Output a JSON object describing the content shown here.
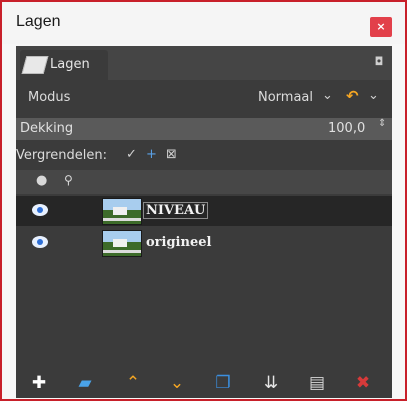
{
  "window": {
    "title": "Lagen",
    "close_glyph": "×"
  },
  "tab": {
    "label": "Lagen",
    "icon": "layers-icon",
    "menu_glyph": "◘"
  },
  "mode": {
    "label": "Modus",
    "value": "Normaal",
    "chevron": "⌄",
    "swap_glyph": "↶",
    "reset_chevron": "⌄"
  },
  "opacity": {
    "label": "Dekking",
    "value": "100,0",
    "spin_glyph": "⇕"
  },
  "lock": {
    "label": "Vergrendelen:",
    "pixels_glyph": "✓",
    "position_glyph": "+",
    "alpha_glyph": "⊠"
  },
  "list_header": {
    "eye_glyph": "●",
    "chain_glyph": "⚲"
  },
  "layers": [
    {
      "name": "NIVEAU",
      "visible": true,
      "selected": true
    },
    {
      "name": "origineel",
      "visible": true,
      "selected": false
    }
  ],
  "bottom_bar": {
    "new_layer": "✚",
    "new_group": "▰",
    "raise": "⌃",
    "lower": "⌄",
    "duplicate": "❐",
    "merge": "⇊",
    "anchor": "▤",
    "delete": "✖"
  },
  "colors": {
    "window_border": "#c8202a",
    "panel_bg": "#3b3b3b",
    "accent_orange": "#f5a623",
    "accent_blue": "#2e6fd6",
    "delete_red": "#d63a3a"
  }
}
